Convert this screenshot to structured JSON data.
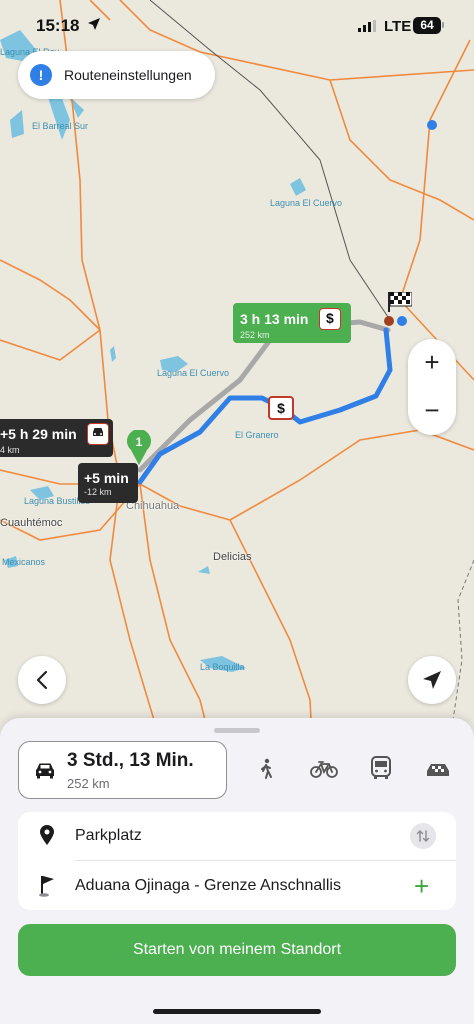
{
  "status_bar": {
    "time": "15:18",
    "network": "LTE",
    "battery": "64"
  },
  "route_settings": {
    "label": "Routeneinstellungen",
    "icon": "info-icon"
  },
  "map": {
    "labels": {
      "laguna_el_rey": "Laguna El Rey",
      "el_barreal_sur": "El Barreal Sur",
      "laguna_el_cuervo_n": "Laguna El Cuervo",
      "laguna_el_cuervo_s": "Laguna El Cuervo",
      "el_granero": "El Granero",
      "laguna_bustillos": "Laguna Bustillos",
      "mexicanos": "Mexicanos",
      "la_boquilla": "La Boquilla",
      "chihuahua": "Chihuahua",
      "cuauhtemoc": "Cuauhtémoc",
      "delicias": "Delicias"
    },
    "main_route": {
      "time": "3 h 13 min",
      "distance": "252 km",
      "tag": "$"
    },
    "alt_route_1": {
      "time": "+5 h 29 min",
      "distance": "4 km",
      "tag": "car-icon"
    },
    "alt_route_2": {
      "time": "+5 min",
      "distance": "-12 km"
    },
    "toll_sign": "$",
    "start_marker": "1",
    "zoom_in": "+",
    "zoom_out": "−",
    "colors": {
      "route_primary": "#2f7fe6",
      "route_alt": "#a8a8a8",
      "road": "#f08a3e",
      "accent_green": "#4caf50"
    }
  },
  "sheet": {
    "car_mode": {
      "duration": "3 Std., 13 Min.",
      "distance": "252 km"
    },
    "modes": [
      "walk-icon",
      "bike-icon",
      "bus-icon",
      "taxi-icon"
    ],
    "origin": "Parkplatz",
    "destination": "Aduana Ojinaga - Grenze Anschnallis",
    "start_button": "Starten von meinem Standort"
  }
}
